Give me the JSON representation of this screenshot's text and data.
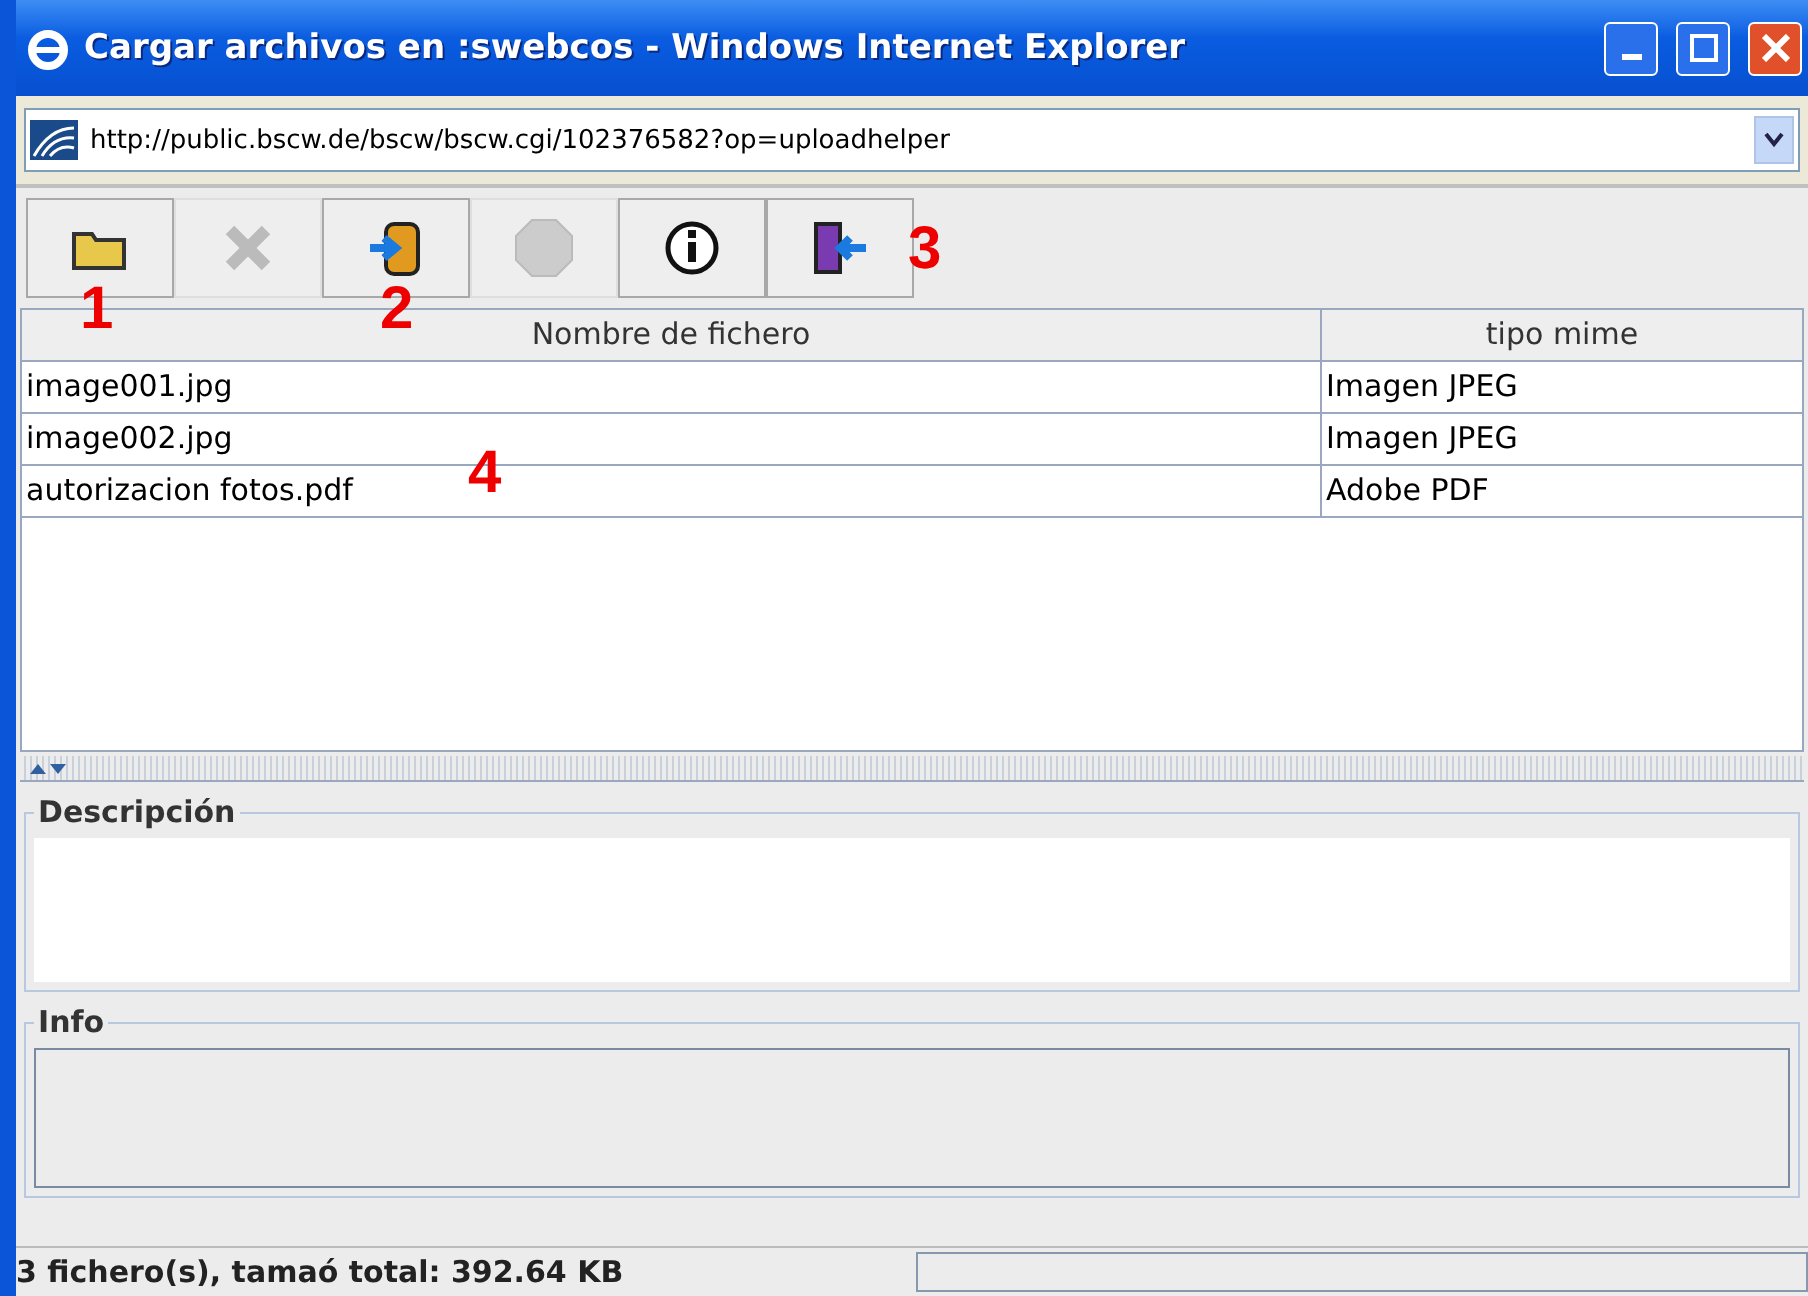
{
  "window": {
    "title": "Cargar archivos en :swebcos - Windows Internet Explorer"
  },
  "address_bar": {
    "url": "http://public.bscw.de/bscw/bscw.cgi/102376582?op=uploadhelper"
  },
  "toolbar": [
    {
      "kind": "folder",
      "disabled": false
    },
    {
      "kind": "delete",
      "disabled": true
    },
    {
      "kind": "upload",
      "disabled": false
    },
    {
      "kind": "stop",
      "disabled": true
    },
    {
      "kind": "info",
      "disabled": false
    },
    {
      "kind": "exit",
      "disabled": false
    }
  ],
  "table": {
    "columns": [
      "Nombre de fichero",
      "tipo mime"
    ],
    "rows": [
      [
        "image001.jpg",
        "Imagen JPEG"
      ],
      [
        "image002.jpg",
        "Imagen JPEG"
      ],
      [
        "autorizacion fotos.pdf",
        "Adobe PDF"
      ]
    ]
  },
  "description": {
    "label": "Descripción"
  },
  "info": {
    "label": "Info"
  },
  "status_bar": {
    "text": "3 fichero(s), tamaó total: 392.64 KB"
  },
  "annotations": [
    "1",
    "2",
    "3",
    "4"
  ]
}
